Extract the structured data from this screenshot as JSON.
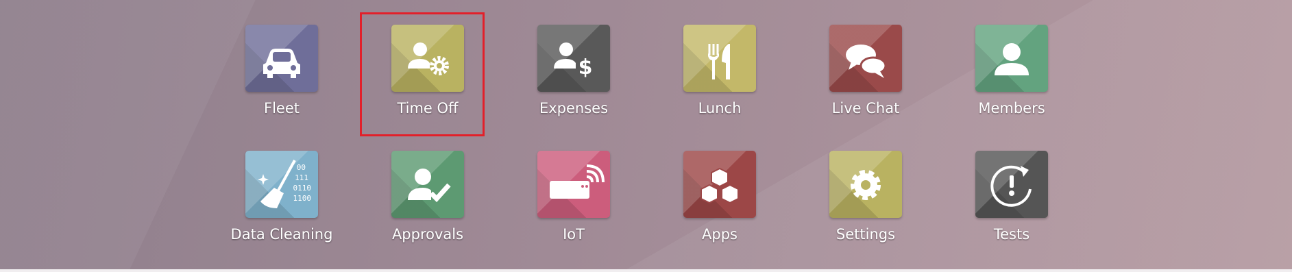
{
  "apps": [
    {
      "label": "Fleet",
      "icon": "car-icon",
      "color": "#6f6e99"
    },
    {
      "label": "Time Off",
      "icon": "user-gear-icon",
      "color": "#b9b261"
    },
    {
      "label": "Expenses",
      "icon": "user-dollar-icon",
      "color": "#595959"
    },
    {
      "label": "Lunch",
      "icon": "fork-knife-icon",
      "color": "#c3b869"
    },
    {
      "label": "Live Chat",
      "icon": "chat-bubbles-icon",
      "color": "#9a4a4a"
    },
    {
      "label": "Members",
      "icon": "user-icon",
      "color": "#63a37f"
    },
    {
      "label": "Data Cleaning",
      "icon": "broom-binary-icon",
      "color": "#7fb1cb"
    },
    {
      "label": "Approvals",
      "icon": "user-check-icon",
      "color": "#5d9a72"
    },
    {
      "label": "IoT",
      "icon": "iot-device-icon",
      "color": "#cc5d7c"
    },
    {
      "label": "Apps",
      "icon": "cubes-icon",
      "color": "#9c4747"
    },
    {
      "label": "Settings",
      "icon": "gear-icon",
      "color": "#b9b261"
    },
    {
      "label": "Tests",
      "icon": "refresh-alert-icon",
      "color": "#555555"
    }
  ],
  "data_cleaning_binary": [
    "00",
    "111",
    "0110",
    "1100"
  ],
  "highlight_color": "#e2202a"
}
